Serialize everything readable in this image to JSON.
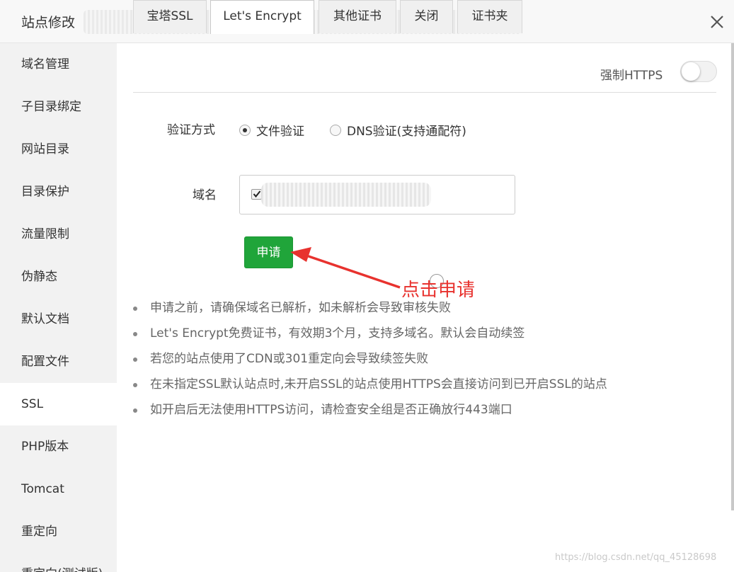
{
  "window": {
    "title": "站点修改"
  },
  "sidebar": {
    "items": [
      {
        "label": "域名管理"
      },
      {
        "label": "子目录绑定"
      },
      {
        "label": "网站目录"
      },
      {
        "label": "目录保护"
      },
      {
        "label": "流量限制"
      },
      {
        "label": "伪静态"
      },
      {
        "label": "默认文档"
      },
      {
        "label": "配置文件"
      },
      {
        "label": "SSL"
      },
      {
        "label": "PHP版本"
      },
      {
        "label": "Tomcat"
      },
      {
        "label": "重定向"
      },
      {
        "label": "重定向(测试版)"
      }
    ],
    "active_index": 8
  },
  "tabs": [
    {
      "label": "宝塔SSL"
    },
    {
      "label": "Let's Encrypt"
    },
    {
      "label": "其他证书"
    },
    {
      "label": "关闭"
    },
    {
      "label": "证书夹"
    }
  ],
  "active_tab": 1,
  "force_https": {
    "label": "强制HTTPS",
    "enabled": false
  },
  "verify": {
    "label": "验证方式",
    "options": [
      {
        "label": "文件验证",
        "checked": true
      },
      {
        "label": "DNS验证(支持通配符)",
        "checked": false
      }
    ]
  },
  "domain": {
    "label": "域名",
    "checked": true
  },
  "apply_button": {
    "label": "申请"
  },
  "annotation": {
    "text": "点击申请",
    "color": "#e8322e"
  },
  "notes": [
    "申请之前，请确保域名已解析，如未解析会导致审核失败",
    "Let's Encrypt免费证书，有效期3个月，支持多域名。默认会自动续签",
    "若您的站点使用了CDN或301重定向会导致续签失败",
    "在未指定SSL默认站点时,未开启SSL的站点使用HTTPS会直接访问到已开启SSL的站点",
    "如开启后无法使用HTTPS访问，请检查安全组是否正确放行443端口"
  ],
  "watermark": "https://blog.csdn.net/qq_45128698",
  "colors": {
    "primary_green": "#20a53a",
    "sidebar_bg": "#f2f2f2"
  }
}
